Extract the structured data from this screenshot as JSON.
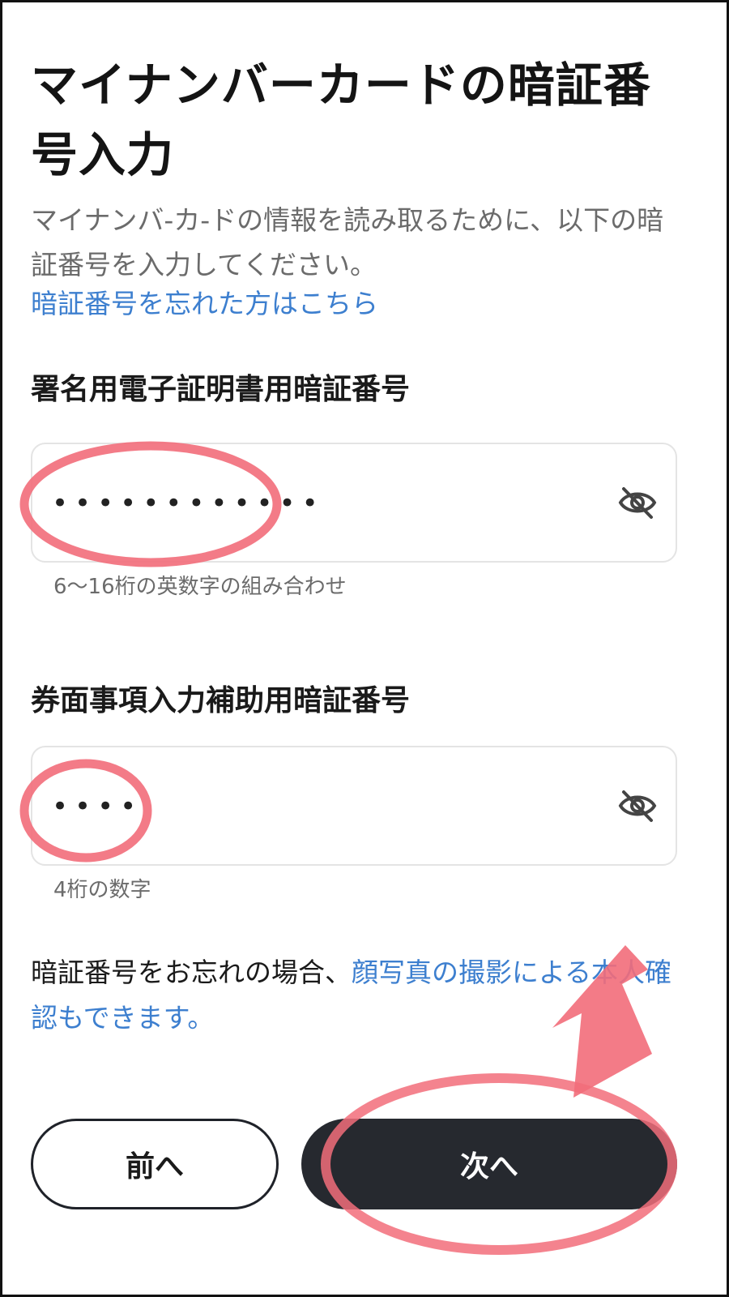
{
  "page": {
    "title": "マイナンバーカードの暗証番号入力",
    "description": "マイナンバ-カ-ドの情報を読み取るために、以下の暗証番号を入力してください。",
    "forgot_link": "暗証番号を忘れた方はこちら"
  },
  "fields": [
    {
      "label": "署名用電子証明書用暗証番号",
      "value": "••••••••••••",
      "hint": "6〜16桁の英数字の組み合わせ",
      "toggle_icon": "eye-slash-icon"
    },
    {
      "label": "券面事項入力補助用暗証番号",
      "value": "••••",
      "hint": "4桁の数字",
      "toggle_icon": "eye-slash-icon"
    }
  ],
  "alternative": {
    "prefix": "暗証番号をお忘れの場合、",
    "link": "顔写真の撮影による本人確認もできます。"
  },
  "buttons": {
    "prev": "前へ",
    "next": "次へ"
  },
  "colors": {
    "link": "#3d7fcf",
    "primary_button": "#26292f",
    "annotation": "#f26d7a"
  }
}
